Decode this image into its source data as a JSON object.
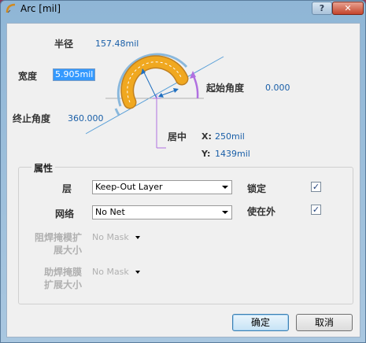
{
  "window": {
    "title": "Arc [mil]"
  },
  "titlebar": {
    "help_label": "?",
    "close_label": "✕"
  },
  "arc": {
    "radius_label": "半径",
    "radius_value": "157.48mil",
    "width_label": "宽度",
    "width_value": "5.905mil",
    "start_angle_label": "起始角度",
    "start_angle_value": "0.000",
    "end_angle_label": "终止角度",
    "end_angle_value": "360.000",
    "center_label": "居中",
    "center_x_label": "X:",
    "center_x_value": "250mil",
    "center_y_label": "Y:",
    "center_y_value": "1439mil"
  },
  "properties": {
    "group_title": "属性",
    "layer_label": "层",
    "layer_value": "Keep-Out Layer",
    "net_label": "网络",
    "net_value": "No Net",
    "locked_label": "锁定",
    "locked_checked": true,
    "keepout_label": "使在外",
    "keepout_checked": true,
    "solder_label_1": "阻焊掩模扩",
    "solder_label_2": "展大小",
    "solder_value": "No Mask",
    "paste_label_1": "助焊掩膜",
    "paste_label_2": "扩展大小",
    "paste_value": "No Mask"
  },
  "buttons": {
    "ok_label": "确定",
    "cancel_label": "取消"
  },
  "icons": [
    "arc-tool-icon",
    "help-icon",
    "close-icon",
    "checkmark-icon",
    "chevron-down-icon"
  ],
  "colors": {
    "arc_fill": "#f0a820",
    "arc_outline": "#c08020",
    "guide_blue": "#5aa0d8",
    "angle_purple": "#b070e0",
    "value_blue": "#1a5fa8"
  }
}
